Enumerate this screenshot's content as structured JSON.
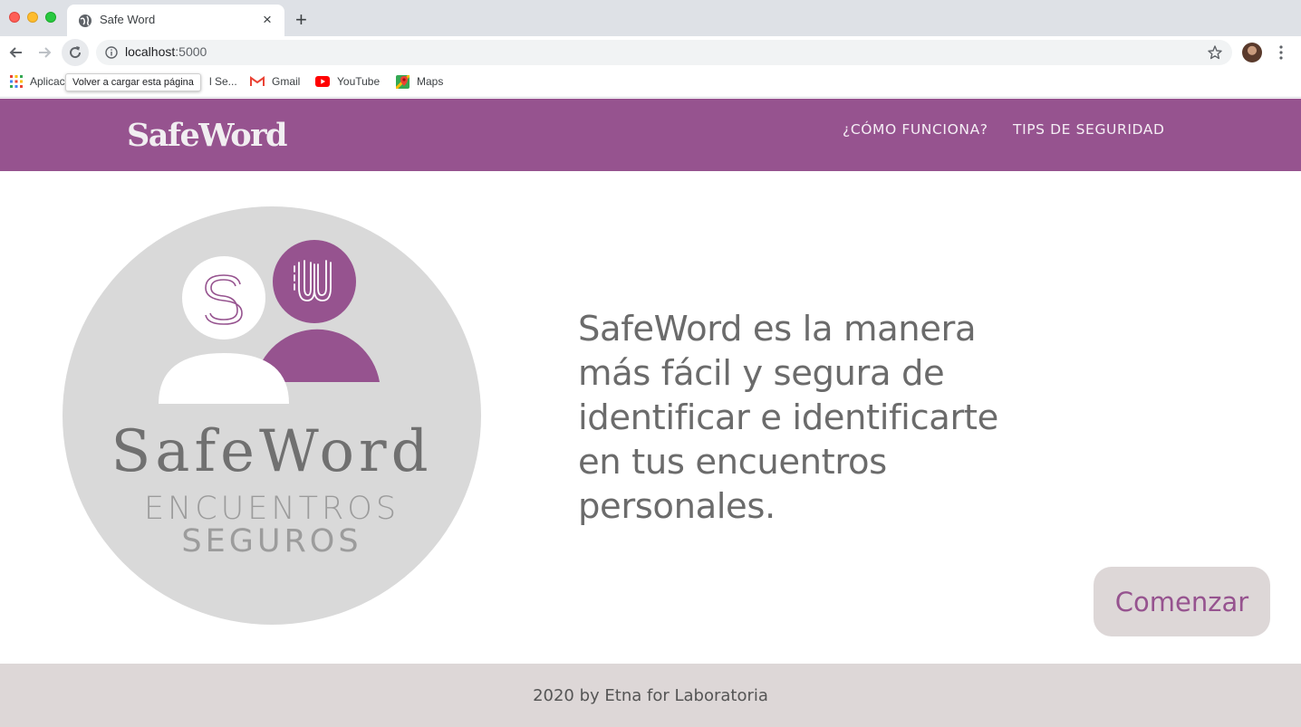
{
  "browser": {
    "tab_title": "Safe Word",
    "tab_close": "×",
    "new_tab": "+",
    "url_host": "localhost",
    "url_port": ":5000",
    "tooltip": "Volver a cargar esta página",
    "bookmarks": [
      {
        "label": "Aplicac",
        "icon": "apps-grid-icon"
      },
      {
        "label": "l Se...",
        "icon": "page-icon"
      },
      {
        "label": "Gmail",
        "icon": "gmail-icon"
      },
      {
        "label": "YouTube",
        "icon": "youtube-icon"
      },
      {
        "label": "Maps",
        "icon": "maps-icon"
      }
    ]
  },
  "header": {
    "brand": "SafeWord",
    "nav": [
      {
        "label": "¿CÓMO FUNCIONA?"
      },
      {
        "label": "TIPS DE SEGURIDAD"
      }
    ]
  },
  "hero": {
    "logo_title": "SafeWord",
    "logo_subtitle_1": "ENCUENTROS",
    "logo_subtitle_2": "SEGUROS",
    "tagline": "SafeWord es la manera más fácil y segura de identificar e identificarte en tus encuentros personales.",
    "cta_label": "Comenzar"
  },
  "footer": {
    "text": "2020 by Etna for Laboratoria"
  },
  "colors": {
    "brand_purple": "#96538f",
    "logo_circle": "#d9d9d9",
    "footer_bg": "#ddd7d7",
    "text_gray": "#6b6b6b"
  }
}
